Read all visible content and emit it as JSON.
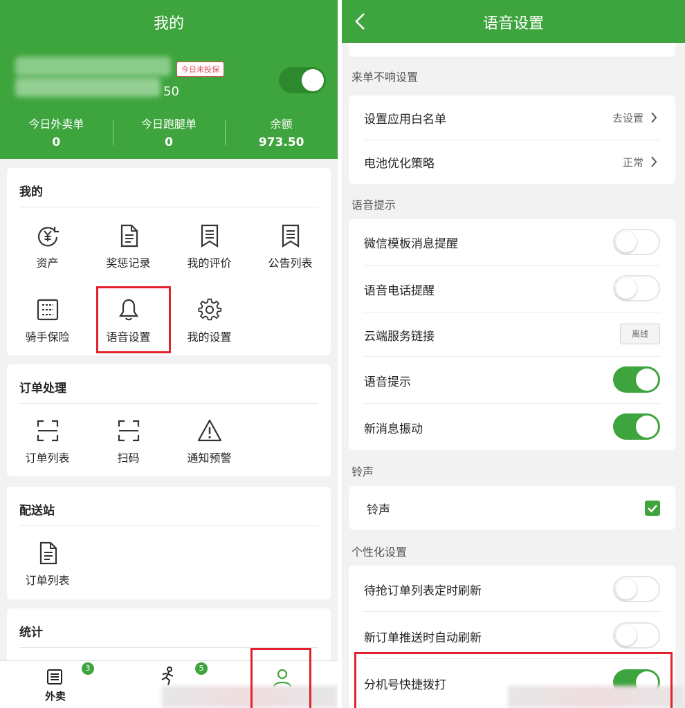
{
  "left": {
    "header": {
      "title": "我的",
      "account_suffix": "50",
      "insurance_badge": "今日未投保",
      "online_toggle_on": true,
      "stats": [
        {
          "label": "今日外卖单",
          "value": "0"
        },
        {
          "label": "今日跑腿单",
          "value": "0"
        },
        {
          "label": "余额",
          "value": "973.50"
        }
      ]
    },
    "mine": {
      "title": "我的",
      "items": [
        {
          "label": "资产",
          "icon": "yuan-refresh-icon"
        },
        {
          "label": "奖惩记录",
          "icon": "document-icon"
        },
        {
          "label": "我的评价",
          "icon": "bookmark-list-icon"
        },
        {
          "label": "公告列表",
          "icon": "bookmark-list-icon"
        },
        {
          "label": "骑手保险",
          "icon": "insurance-card-icon"
        },
        {
          "label": "语音设置",
          "icon": "bell-icon"
        },
        {
          "label": "我的设置",
          "icon": "gear-icon"
        }
      ]
    },
    "orders": {
      "title": "订单处理",
      "items": [
        {
          "label": "订单列表",
          "icon": "scan-frame-icon"
        },
        {
          "label": "扫码",
          "icon": "scan-frame-icon"
        },
        {
          "label": "通知预警",
          "icon": "warning-icon"
        }
      ]
    },
    "station": {
      "title": "配送站",
      "items": [
        {
          "label": "订单列表",
          "icon": "document-icon"
        }
      ]
    },
    "stats_section": {
      "title": "统计"
    },
    "tabbar": {
      "tabs": [
        {
          "label": "外卖",
          "badge": "3",
          "icon": "list-icon"
        },
        {
          "label": "",
          "badge": "5",
          "icon": "runner-icon"
        },
        {
          "label": "",
          "badge": "",
          "icon": "person-icon"
        }
      ]
    }
  },
  "right": {
    "header": {
      "title": "语音设置"
    },
    "sections": [
      {
        "label": "来单不响设置",
        "rows": [
          {
            "label": "设置应用白名单",
            "value": "去设置",
            "control": "chevron"
          },
          {
            "label": "电池优化策略",
            "value": "正常",
            "control": "chevron"
          }
        ]
      },
      {
        "label": "语音提示",
        "rows": [
          {
            "label": "微信模板消息提醒",
            "control": "toggle",
            "on": false
          },
          {
            "label": "语音电话提醒",
            "control": "toggle",
            "on": false
          },
          {
            "label": "云端服务链接",
            "control": "button",
            "button_label": "离线"
          },
          {
            "label": "语音提示",
            "control": "toggle",
            "on": true
          },
          {
            "label": "新消息振动",
            "control": "toggle",
            "on": true
          }
        ]
      },
      {
        "label": "铃声",
        "rows": [
          {
            "label": "铃声",
            "control": "checkbox",
            "checked": true
          }
        ]
      },
      {
        "label": "个性化设置",
        "rows": [
          {
            "label": "待抢订单列表定时刷新",
            "control": "toggle",
            "on": false
          },
          {
            "label": "新订单推送时自动刷新",
            "control": "toggle",
            "on": false
          },
          {
            "label": "分机号快捷拨打",
            "control": "toggle",
            "on": true
          }
        ]
      }
    ]
  },
  "colors": {
    "brand_green": "#3ea43d",
    "highlight_red": "#e3202c",
    "badge_red": "#e0505a"
  }
}
